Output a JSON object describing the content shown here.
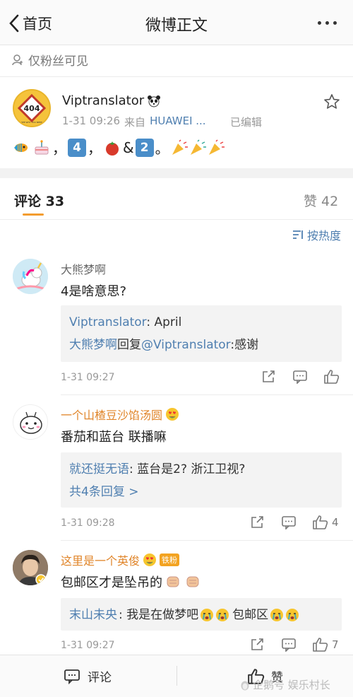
{
  "nav": {
    "back_label": "首页",
    "title": "微博正文"
  },
  "visibility": "仅粉丝可见",
  "post": {
    "author": "Viptranslator",
    "time": "1-31 09:26",
    "source_prefix": "来自",
    "source": "HUAWEI ...",
    "edited": "已编辑",
    "avatar_text": "404",
    "avatar_subtext": "SEE WHY YOU NEED",
    "body": {
      "comma": "，",
      "num4": "4",
      "amp": "&",
      "num2": "2",
      "period": "。"
    }
  },
  "tabs": {
    "comments": "评论 33",
    "likes": "赞 42"
  },
  "sort_label": "按热度",
  "comments": [
    {
      "name": "大熊梦啊",
      "text": "4是啥意思?",
      "replies": [
        {
          "user": "Viptranslator",
          "text": ": April"
        },
        {
          "user": "大熊梦啊",
          "mid": "回复",
          "mention": "@Viptranslator",
          "text": ":感谢"
        }
      ],
      "time": "1-31 09:27"
    },
    {
      "name": "一个山楂豆沙馅汤圆",
      "text": "番茄和蓝台 联播嘛",
      "reply": {
        "user": "就还挺无语",
        "text": ": 蓝台是2? 浙江卫视?"
      },
      "more": "共4条回复 >",
      "time": "1-31 09:28",
      "likes": "4"
    },
    {
      "name": "这里是一个英俊",
      "badge": "铁粉",
      "text": "包邮区才是坠吊的",
      "reply": {
        "user": "末山未央",
        "text": ": 我是在做梦吧",
        "tail": "包邮区"
      },
      "time": "1-31 09:27",
      "likes": "7"
    }
  ],
  "bottom": {
    "comment": "评论",
    "like": "赞"
  },
  "watermark": "企鹅号 娱乐村长",
  "colors": {
    "link": "#4f7fb0",
    "accent": "#f39c2f",
    "gold_name": "#e0852a"
  }
}
